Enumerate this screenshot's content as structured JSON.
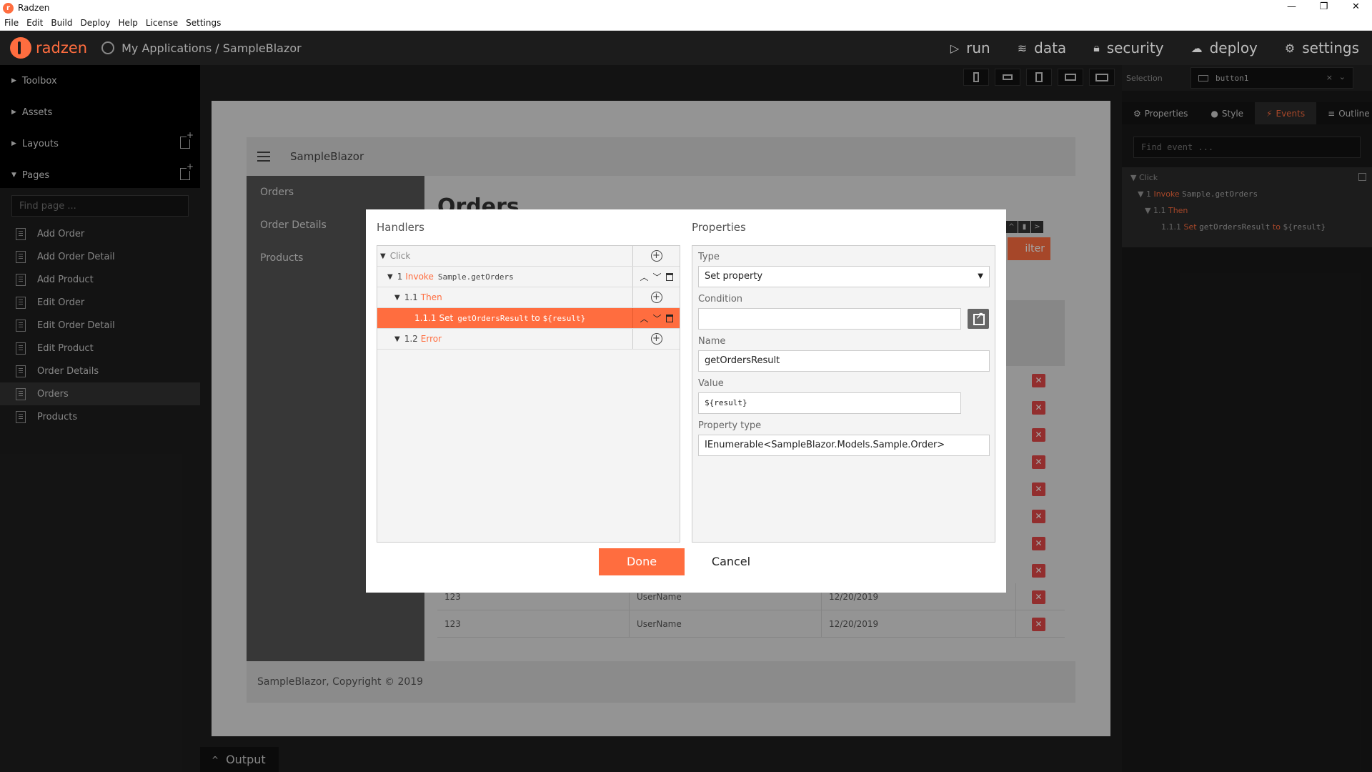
{
  "window": {
    "title": "Radzen",
    "controls": [
      "—",
      "❐",
      "✕"
    ]
  },
  "menu": [
    "File",
    "Edit",
    "Build",
    "Deploy",
    "Help",
    "License",
    "Settings"
  ],
  "header": {
    "logo_text": "radzen",
    "breadcrumb": "My Applications / SampleBlazor",
    "nav": [
      {
        "icon": "play-icon",
        "glyph": "▷",
        "label": "run"
      },
      {
        "icon": "layers-icon",
        "glyph": "≋",
        "label": "data"
      },
      {
        "icon": "lock-icon",
        "glyph": "🔒︎",
        "label": "security"
      },
      {
        "icon": "cloud-icon",
        "glyph": "☁",
        "label": "deploy"
      },
      {
        "icon": "gear-icon",
        "glyph": "⚙",
        "label": "settings"
      }
    ]
  },
  "sidebar": {
    "sections": [
      "Toolbox",
      "Assets",
      "Layouts",
      "Pages"
    ],
    "find_placeholder": "Find page ...",
    "pages": [
      "Add Order",
      "Add Order Detail",
      "Add Product",
      "Edit Order",
      "Edit Order Detail",
      "Edit Product",
      "Order Details",
      "Orders",
      "Products"
    ],
    "active_page": "Orders"
  },
  "canvas": {
    "app_title": "SampleBlazor",
    "nav": [
      "Orders",
      "Order Details",
      "Products"
    ],
    "page_heading": "Orders",
    "filter_label": "ilter",
    "rows": [
      {
        "id": "123",
        "user": "UserName",
        "date": "12/20/2019"
      },
      {
        "id": "123",
        "user": "UserName",
        "date": "12/20/2019"
      }
    ],
    "delete_glyph": "✕",
    "footer": "SampleBlazor, Copyright © 2019"
  },
  "output_tab": "Output",
  "right_panel": {
    "selection_label": "Selection",
    "selection_value": "button1",
    "tabs": [
      "Properties",
      "Style",
      "Events",
      "Outline"
    ],
    "active_tab": "Events",
    "find_event_placeholder": "Find event ...",
    "tree": {
      "click": "Click",
      "invoke_num": "1",
      "invoke_kw": "Invoke",
      "invoke_target": "Sample.getOrders",
      "then_num": "1.1",
      "then_kw": "Then",
      "set_num": "1.1.1",
      "set_kw": "Set",
      "set_name": "getOrdersResult",
      "set_to": "to",
      "set_value": "${result}"
    }
  },
  "dialog": {
    "handlers_title": "Handlers",
    "properties_title": "Properties",
    "handlers": {
      "click": "Click",
      "invoke_num": "1",
      "invoke_kw": "Invoke",
      "invoke_target": "Sample.getOrders",
      "then_num": "1.1",
      "then_kw": "Then",
      "set_num": "1.1.1",
      "set_kw": "Set",
      "set_name": "getOrdersResult",
      "set_to": "to",
      "set_value": "${result}",
      "error_num": "1.2",
      "error_kw": "Error"
    },
    "properties": {
      "type_label": "Type",
      "type_value": "Set property",
      "condition_label": "Condition",
      "condition_value": "",
      "name_label": "Name",
      "name_value": "getOrdersResult",
      "value_label": "Value",
      "value_value": "${result}",
      "property_type_label": "Property type",
      "property_type_value": "IEnumerable<SampleBlazor.Models.Sample.Order>"
    },
    "done_label": "Done",
    "cancel_label": "Cancel"
  },
  "colors": {
    "accent": "#ff6d3f",
    "danger": "#e04848"
  }
}
